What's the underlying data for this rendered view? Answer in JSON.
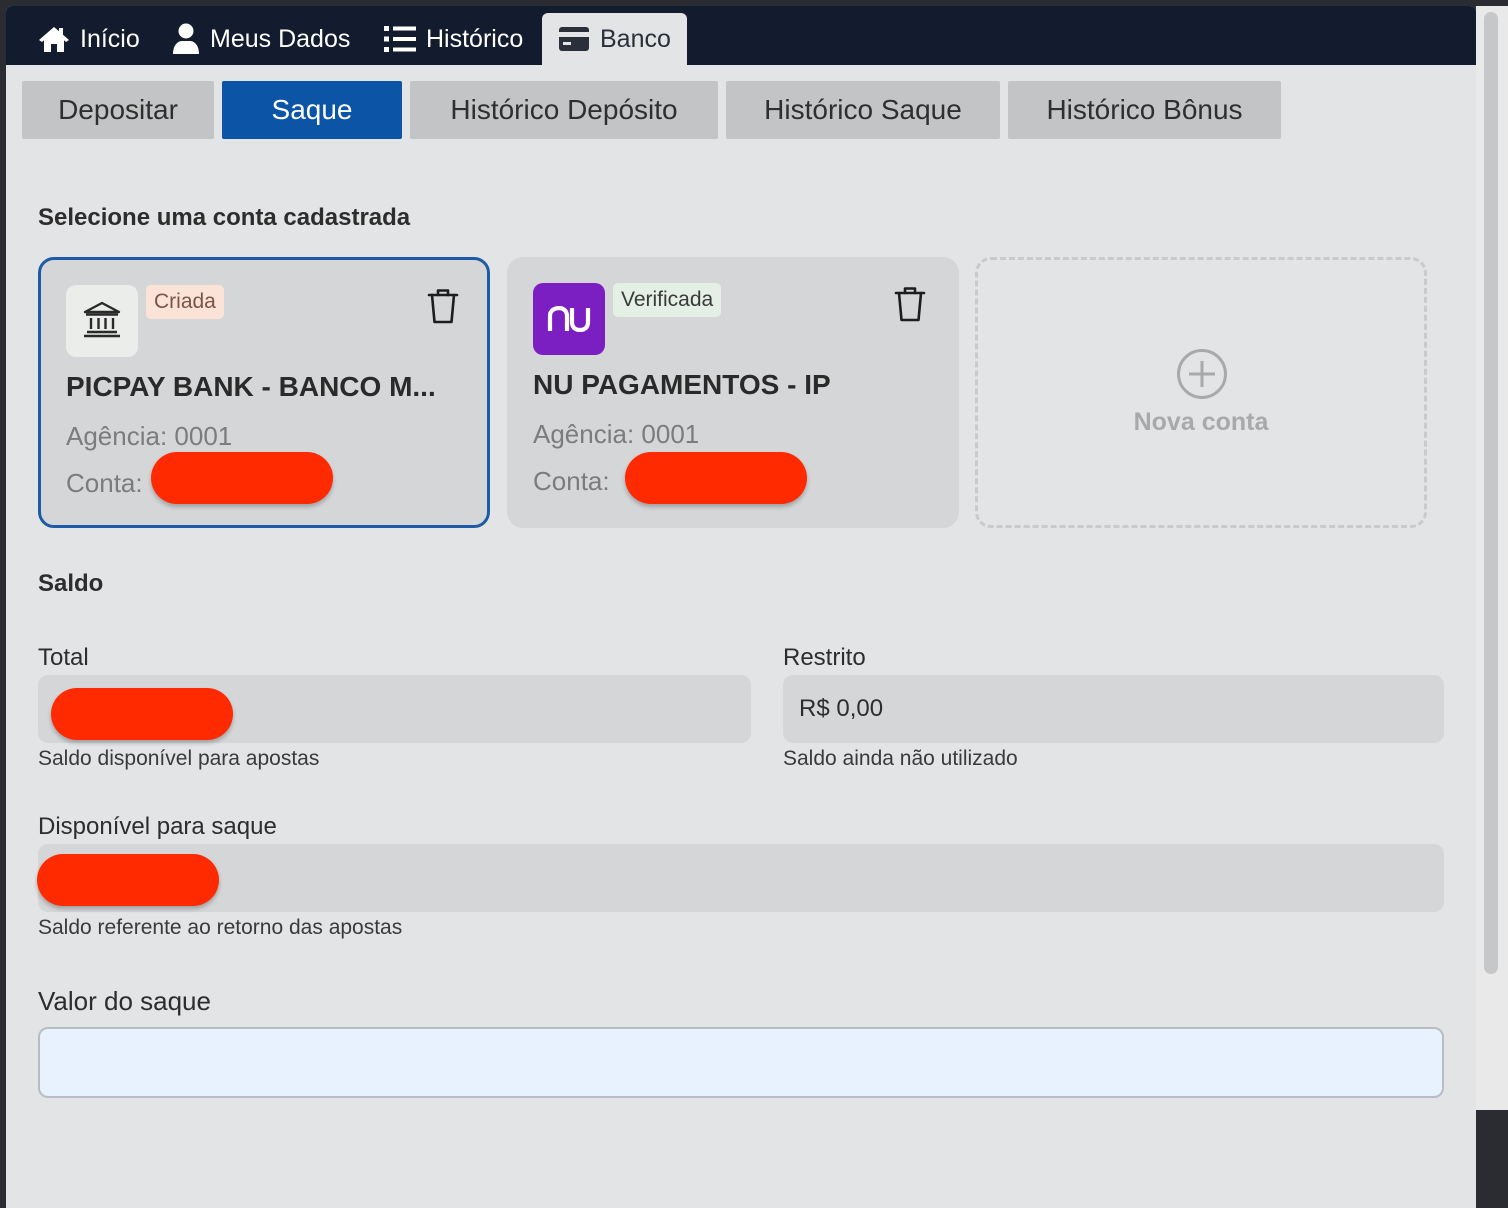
{
  "topnav": {
    "items": [
      {
        "label": "Início",
        "icon": "home-icon"
      },
      {
        "label": "Meus Dados",
        "icon": "user-icon"
      },
      {
        "label": "Histórico",
        "icon": "list-icon"
      },
      {
        "label": "Banco",
        "icon": "credit-card-icon",
        "active": true
      }
    ]
  },
  "subtabs": [
    {
      "label": "Depositar"
    },
    {
      "label": "Saque",
      "active": true
    },
    {
      "label": "Histórico Depósito"
    },
    {
      "label": "Histórico Saque"
    },
    {
      "label": "Histórico Bônus"
    }
  ],
  "accounts": {
    "title": "Selecione uma conta cadastrada",
    "cards": [
      {
        "bank": "PICPAY BANK - BANCO M...",
        "status": "Criada",
        "agencia": "Agência: 0001",
        "conta_label": "Conta:",
        "logo": "bank-building-icon",
        "selected": true
      },
      {
        "bank": "NU PAGAMENTOS - IP",
        "status": "Verificada",
        "agencia": "Agência: 0001",
        "conta_label": "Conta:",
        "logo_text": "nu",
        "selected": false
      }
    ],
    "new_account_label": "Nova conta"
  },
  "saldo": {
    "title": "Saldo",
    "total": {
      "label": "Total",
      "help": "Saldo disponível para apostas"
    },
    "restrito": {
      "label": "Restrito",
      "value": "R$ 0,00",
      "help": "Saldo ainda não utilizado"
    },
    "disponivel": {
      "label": "Disponível para saque",
      "help": "Saldo referente ao retorno das apostas"
    }
  },
  "saque": {
    "label": "Valor do saque",
    "value": ""
  },
  "colors": {
    "nav_bg": "#131c2e",
    "accent": "#0b54a6",
    "redaction": "#ff2a00",
    "nubank": "#7c1fc2"
  }
}
